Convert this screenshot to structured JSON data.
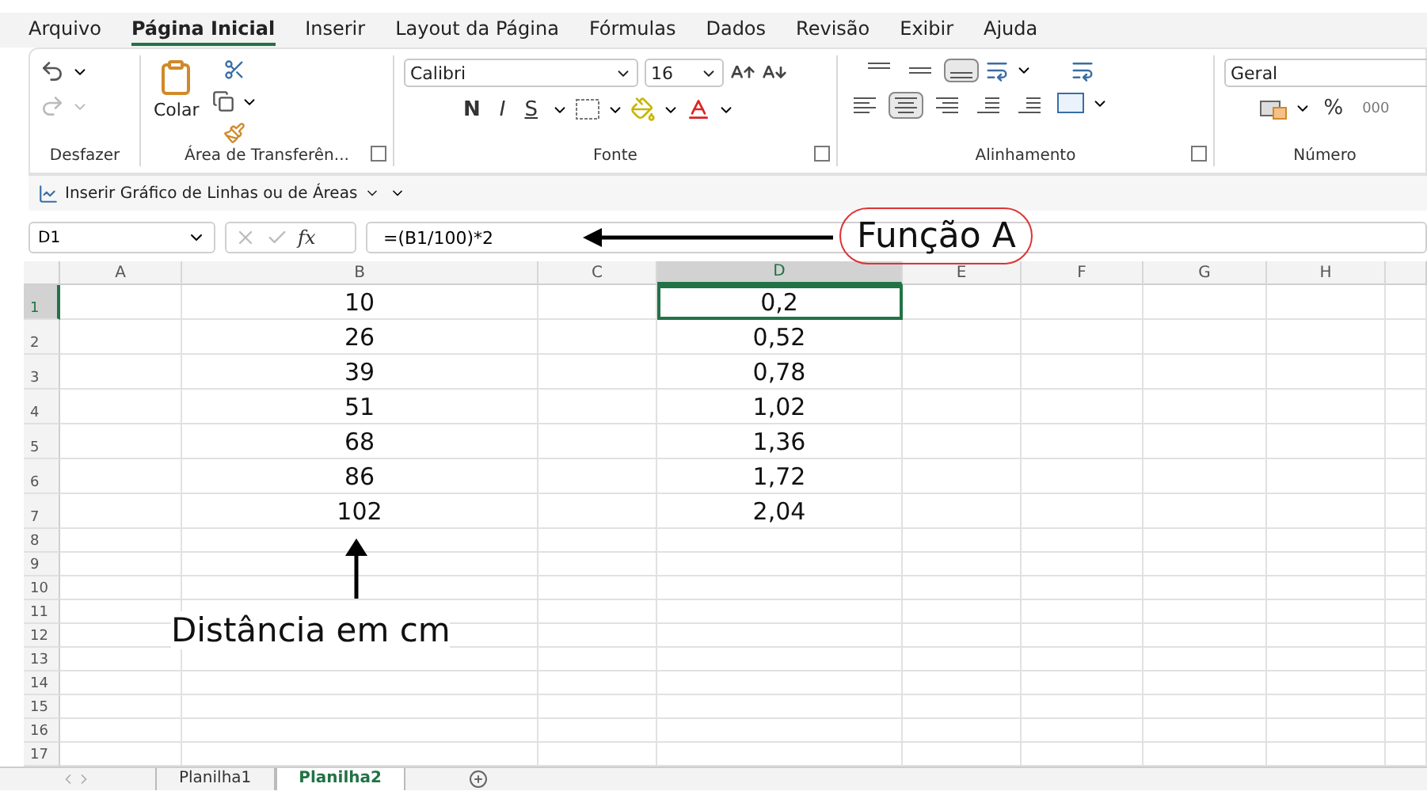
{
  "menu_tabs": [
    {
      "label": "Arquivo",
      "selected": false
    },
    {
      "label": "Página Inicial",
      "selected": true
    },
    {
      "label": "Inserir",
      "selected": false
    },
    {
      "label": "Layout da Página",
      "selected": false
    },
    {
      "label": "Fórmulas",
      "selected": false
    },
    {
      "label": "Dados",
      "selected": false
    },
    {
      "label": "Revisão",
      "selected": false
    },
    {
      "label": "Exibir",
      "selected": false
    },
    {
      "label": "Ajuda",
      "selected": false
    }
  ],
  "ribbon": {
    "undo": {
      "group_label": "Desfazer"
    },
    "clipboard": {
      "paste_label": "Colar",
      "group_label": "Área de Transferên..."
    },
    "font": {
      "name": "Calibri",
      "size": "16",
      "bold": "N",
      "italic": "I",
      "underline": "S",
      "group_label": "Fonte"
    },
    "alignment": {
      "group_label": "Alinhamento",
      "vertical": [
        {
          "kind": "top",
          "pressed": false
        },
        {
          "kind": "middle",
          "pressed": false
        },
        {
          "kind": "bottom",
          "pressed": true
        }
      ],
      "horizontal": [
        {
          "kind": "left",
          "pressed": false
        },
        {
          "kind": "center",
          "pressed": true
        },
        {
          "kind": "right",
          "pressed": false
        },
        {
          "kind": "outdent",
          "pressed": false
        },
        {
          "kind": "indent",
          "pressed": false
        }
      ]
    },
    "number": {
      "format": "Geral",
      "percent": "%",
      "thousands": "000",
      "group_label": "Número"
    }
  },
  "quick_bar": {
    "label": "Inserir Gráfico de Linhas ou de Áreas"
  },
  "formula_bar": {
    "name_box": "D1",
    "fx": "fx",
    "formula": "=(B1/100)*2"
  },
  "sheet": {
    "columns": [
      {
        "label": "A",
        "selected": false
      },
      {
        "label": "B",
        "selected": false
      },
      {
        "label": "C",
        "selected": false
      },
      {
        "label": "D",
        "selected": true
      },
      {
        "label": "E",
        "selected": false
      },
      {
        "label": "F",
        "selected": false
      },
      {
        "label": "G",
        "selected": false
      },
      {
        "label": "H",
        "selected": false
      }
    ],
    "rows": [
      {
        "number": "1",
        "selected": true,
        "b": "10",
        "d": "0,2"
      },
      {
        "number": "2",
        "selected": false,
        "b": "26",
        "d": "0,52"
      },
      {
        "number": "3",
        "selected": false,
        "b": "39",
        "d": "0,78"
      },
      {
        "number": "4",
        "selected": false,
        "b": "51",
        "d": "1,02"
      },
      {
        "number": "5",
        "selected": false,
        "b": "68",
        "d": "1,36"
      },
      {
        "number": "6",
        "selected": false,
        "b": "86",
        "d": "1,72"
      },
      {
        "number": "7",
        "selected": false,
        "b": "102",
        "d": "2,04"
      },
      {
        "number": "8",
        "selected": false
      },
      {
        "number": "9",
        "selected": false
      },
      {
        "number": "10",
        "selected": false
      },
      {
        "number": "11",
        "selected": false
      },
      {
        "number": "12",
        "selected": false
      },
      {
        "number": "13",
        "selected": false
      },
      {
        "number": "14",
        "selected": false
      },
      {
        "number": "15",
        "selected": false
      },
      {
        "number": "16",
        "selected": false
      },
      {
        "number": "17",
        "selected": false
      }
    ]
  },
  "annotations": {
    "formula_label": "Função A",
    "axis_label": "Distância em cm"
  },
  "sheet_tabs": [
    {
      "label": "Planilha1",
      "selected": false
    },
    {
      "label": "Planilha2",
      "selected": true
    }
  ]
}
